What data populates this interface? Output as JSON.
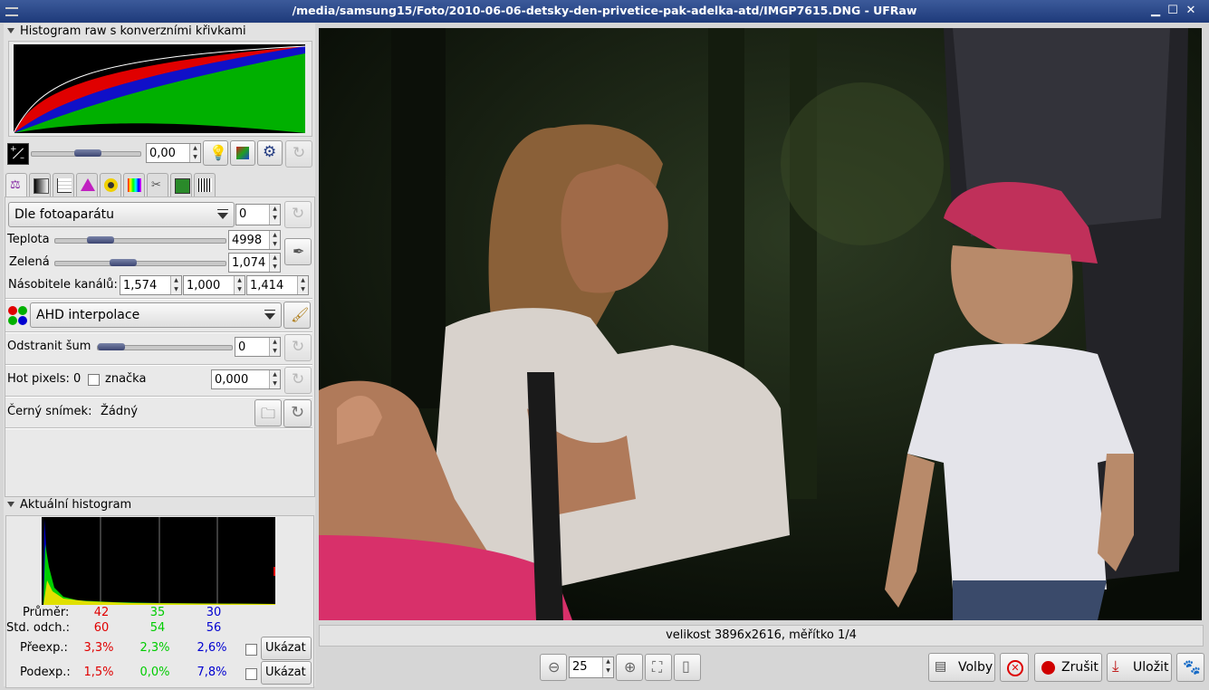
{
  "window": {
    "title": "/media/samsung15/Foto/2010-06-06-detsky-den-privetice-pak-adelka-atd/IMGP7615.DNG - UFRaw"
  },
  "raw_histogram": {
    "title": "Histogram raw s konverzními křivkami"
  },
  "exposure": {
    "value": "0,00"
  },
  "white_balance": {
    "mode": "Dle fotoaparátu",
    "fine_tune": "0",
    "temperature_label": "Teplota",
    "temperature_value": "4998",
    "green_label": "Zelená",
    "green_value": "1,074",
    "multipliers_label": "Násobitele kanálů:",
    "mult_r": "1,574",
    "mult_g": "1,000",
    "mult_b": "1,414"
  },
  "interpolation": {
    "value": "AHD interpolace"
  },
  "denoise": {
    "label": "Odstranit šum",
    "value": "0"
  },
  "hotpixels": {
    "label": "Hot pixels: 0",
    "mark_label": "značka",
    "value": "0,000"
  },
  "darkframe": {
    "label": "Černý snímek:",
    "value": "Žádný"
  },
  "live_histogram": {
    "title": "Aktuální histogram",
    "mean_label": "Průměr:",
    "mean": [
      "42",
      "35",
      "30"
    ],
    "std_label": "Std. odch.:",
    "std": [
      "60",
      "54",
      "56"
    ],
    "over_label": "Přeexp.:",
    "over": [
      "3,3%",
      "2,3%",
      "2,6%"
    ],
    "under_label": "Podexp.:",
    "under": [
      "1,5%",
      "0,0%",
      "7,8%"
    ],
    "show_label": "Ukázat",
    "colors": [
      "#e00000",
      "#00cc00",
      "#0000d0"
    ]
  },
  "status": {
    "text": "velikost 3896x2616, měřítko 1/4"
  },
  "zoom": {
    "value": "25"
  },
  "actions": {
    "options_label": "Volby",
    "cancel_label": "Zrušit",
    "save_label": "Uložit"
  }
}
